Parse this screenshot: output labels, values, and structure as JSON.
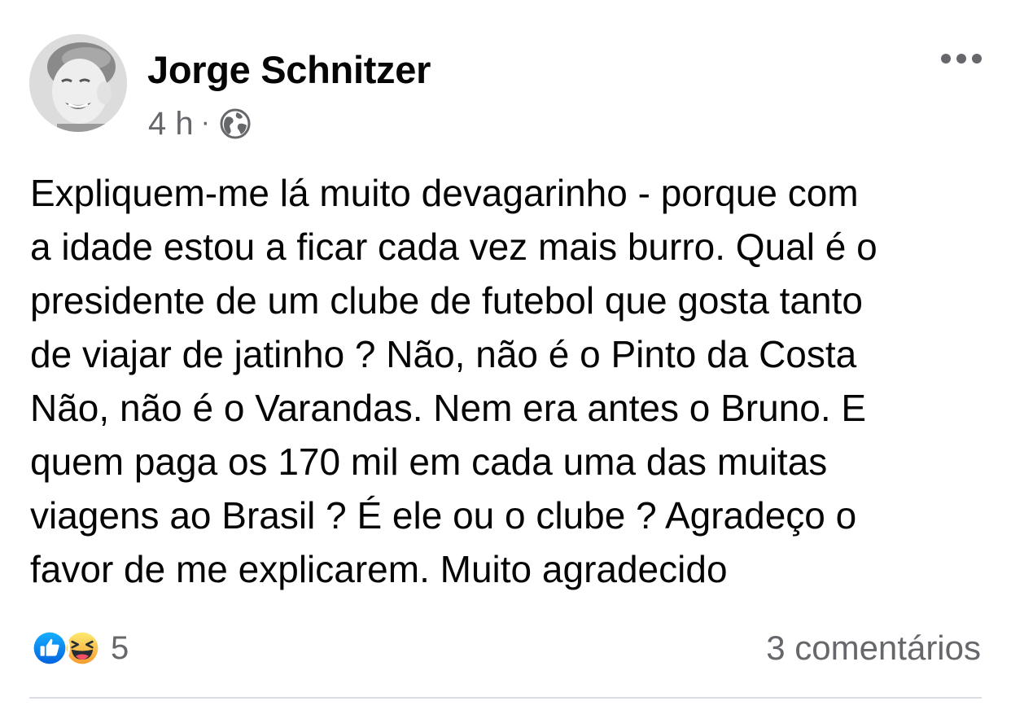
{
  "post": {
    "author": "Jorge Schnitzer",
    "time": "4 h",
    "separator": "·",
    "audience_icon": "globe-icon",
    "more_icon": "more-options-icon",
    "body_lines": [
      "Expliquem-me lá muito devagarinho - porque com",
      "a idade estou a ficar cada vez mais burro. Qual é o",
      "presidente de um clube de futebol que gosta tanto",
      "de viajar de jatinho ? Não, não é o Pinto da Costa",
      "Não, não é o Varandas. Nem era antes o Bruno. E",
      "quem paga os 170 mil em cada uma das muitas",
      "viagens ao Brasil ? É ele ou o clube ? Agradeço o",
      "favor de me explicarem. Muito agradecido"
    ]
  },
  "reactions": {
    "icons": [
      "like-icon",
      "haha-icon"
    ],
    "count": "5"
  },
  "comments": {
    "label": "3 comentários"
  },
  "colors": {
    "text": "#050505",
    "secondary": "#65676b",
    "like_blue": "#1877f2",
    "haha_yellow": "#f7b125",
    "divider": "#dadde1"
  }
}
